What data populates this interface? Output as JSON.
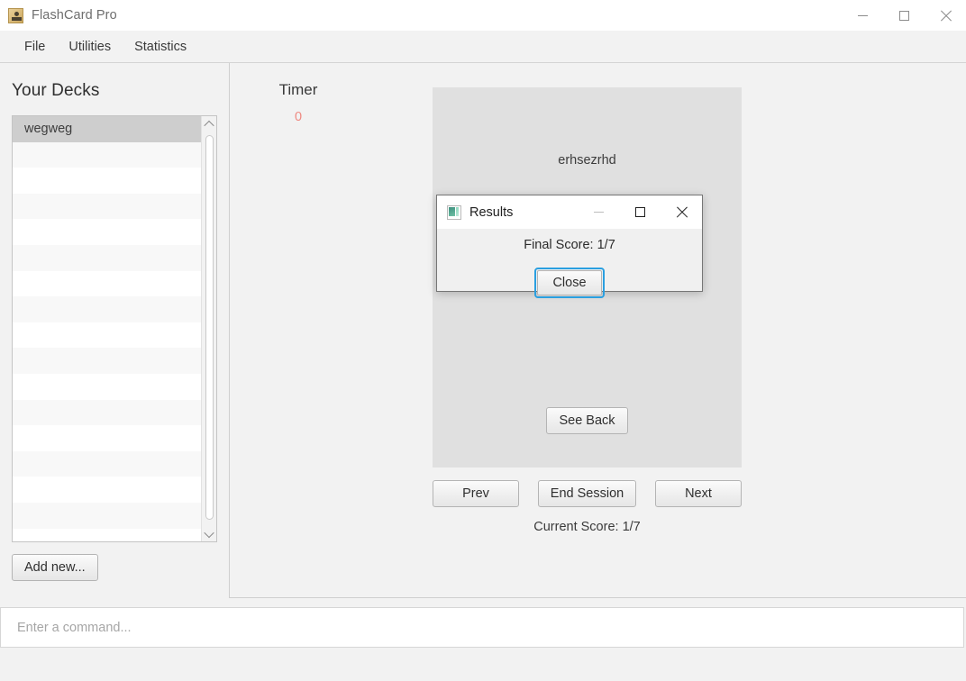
{
  "window": {
    "title": "FlashCard Pro",
    "icon": "app-person-icon",
    "controls": {
      "minimize": "minimize-icon",
      "maximize": "maximize-icon",
      "close": "close-icon"
    }
  },
  "menubar": {
    "items": [
      {
        "label": "File"
      },
      {
        "label": "Utilities"
      },
      {
        "label": "Statistics"
      }
    ]
  },
  "sidebar": {
    "title": "Your Decks",
    "decks": [
      {
        "label": "wegweg",
        "selected": true
      },
      {
        "label": "",
        "selected": false
      },
      {
        "label": "",
        "selected": false
      },
      {
        "label": "",
        "selected": false
      },
      {
        "label": "",
        "selected": false
      },
      {
        "label": "",
        "selected": false
      },
      {
        "label": "",
        "selected": false
      },
      {
        "label": "",
        "selected": false
      },
      {
        "label": "",
        "selected": false
      },
      {
        "label": "",
        "selected": false
      },
      {
        "label": "",
        "selected": false
      },
      {
        "label": "",
        "selected": false
      },
      {
        "label": "",
        "selected": false
      },
      {
        "label": "",
        "selected": false
      },
      {
        "label": "",
        "selected": false
      },
      {
        "label": "",
        "selected": false
      }
    ],
    "scrollbar": {
      "up_arrow": "chevron-up-icon",
      "down_arrow": "chevron-down-icon"
    },
    "add_new_label": "Add new..."
  },
  "main": {
    "timer": {
      "label": "Timer",
      "value": "0",
      "value_color": "#ef8a82"
    },
    "card": {
      "front_text": "erhsezrhd",
      "see_back_label": "See Back"
    },
    "nav": {
      "prev_label": "Prev",
      "end_session_label": "End Session",
      "next_label": "Next"
    },
    "current_score": "Current Score: 1/7"
  },
  "command_bar": {
    "placeholder": "Enter a command...",
    "value": ""
  },
  "dialog": {
    "title": "Results",
    "icon": "results-window-icon",
    "message": "Final Score: 1/7",
    "close_label": "Close",
    "focus_color": "#2a9fe0",
    "controls": {
      "minimize": "minimize-icon",
      "maximize": "maximize-icon",
      "close": "close-icon"
    }
  }
}
